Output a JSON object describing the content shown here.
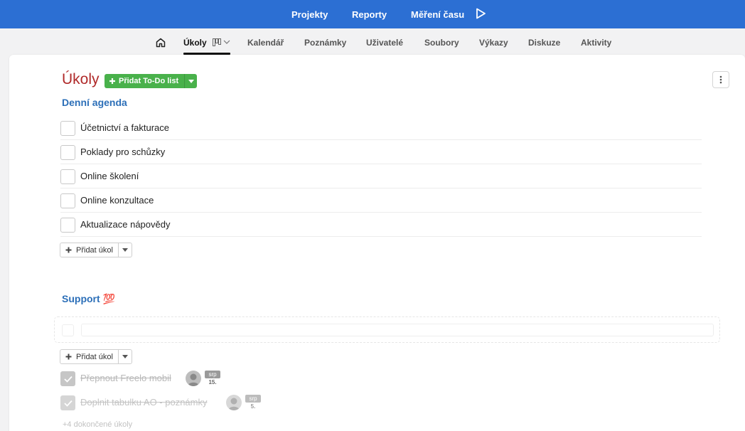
{
  "topnav": {
    "projects": "Projekty",
    "reports": "Reporty",
    "time_tracking": "Měření času"
  },
  "subnav": {
    "tabs": [
      "Úkoly",
      "Kalendář",
      "Poznámky",
      "Uživatelé",
      "Soubory",
      "Výkazy",
      "Diskuze",
      "Aktivity"
    ]
  },
  "main": {
    "title": "Úkoly",
    "add_list_label": "Přidat To-Do list"
  },
  "lists": [
    {
      "title": "Denní agenda",
      "tasks": [
        "Účetnictví a fakturace",
        "Poklady pro schůzky",
        "Online školení",
        "Online konzultace",
        "Aktualizace nápovědy"
      ],
      "add_task_label": "Přidat úkol"
    },
    {
      "title": "Support 💯",
      "new_task_placeholder": "",
      "add_task_label": "Přidat úkol",
      "done_tasks": [
        {
          "label": "Přepnout Freelo mobil",
          "month": "srp",
          "day": "15."
        },
        {
          "label": "Doplnit tabulku AO - poznámky",
          "month": "srp",
          "day": "5."
        }
      ],
      "more_done": "+4 dokončené úkoly"
    }
  ],
  "colors": {
    "topbar": "#2c6fd3",
    "title": "#b02a2a",
    "section": "#2c6fb8",
    "green": "#49b14b"
  }
}
